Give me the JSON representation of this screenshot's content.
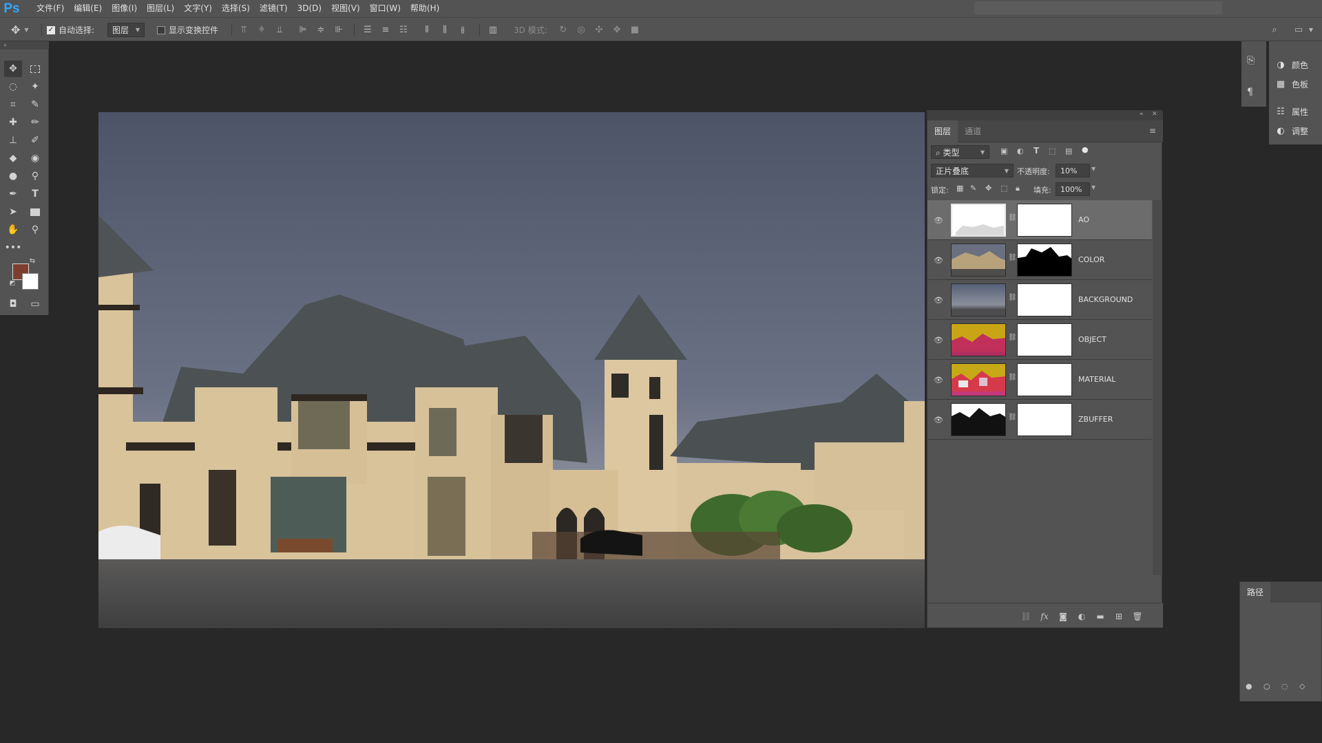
{
  "app": {
    "logo": "Ps",
    "accent_color": "#31a8ff"
  },
  "menu": [
    "文件(F)",
    "编辑(E)",
    "图像(I)",
    "图层(L)",
    "文字(Y)",
    "选择(S)",
    "滤镜(T)",
    "3D(D)",
    "视图(V)",
    "窗口(W)",
    "帮助(H)"
  ],
  "options_bar": {
    "auto_select_label": "自动选择:",
    "auto_select_checked": true,
    "auto_select_target": "图层",
    "show_transform_label": "显示变换控件",
    "show_transform_checked": false,
    "mode_3d_label": "3D 模式:"
  },
  "colors": {
    "foreground": "#7d3e2c",
    "background": "#ffffff"
  },
  "layers_panel": {
    "tabs": [
      "图层",
      "通道"
    ],
    "active_tab": "图层",
    "filter_kind": "类型",
    "blend_mode": "正片叠底",
    "opacity_label": "不透明度:",
    "opacity_value": "10%",
    "lock_label": "锁定:",
    "fill_label": "填充:",
    "fill_value": "100%",
    "layers": [
      {
        "name": "AO",
        "selected": true
      },
      {
        "name": "COLOR",
        "selected": false
      },
      {
        "name": "BACKGROUND",
        "selected": false
      },
      {
        "name": "OBJECT",
        "selected": false
      },
      {
        "name": "MATERIAL",
        "selected": false
      },
      {
        "name": "ZBUFFER",
        "selected": false
      }
    ]
  },
  "right_dock": {
    "items": [
      {
        "label": "颜色",
        "icon": "color-icon"
      },
      {
        "label": "色板",
        "icon": "swatches-icon"
      },
      {
        "label": "属性",
        "icon": "properties-icon"
      },
      {
        "label": "调整",
        "icon": "adjustments-icon"
      }
    ]
  },
  "paths_panel": {
    "title": "路径"
  }
}
